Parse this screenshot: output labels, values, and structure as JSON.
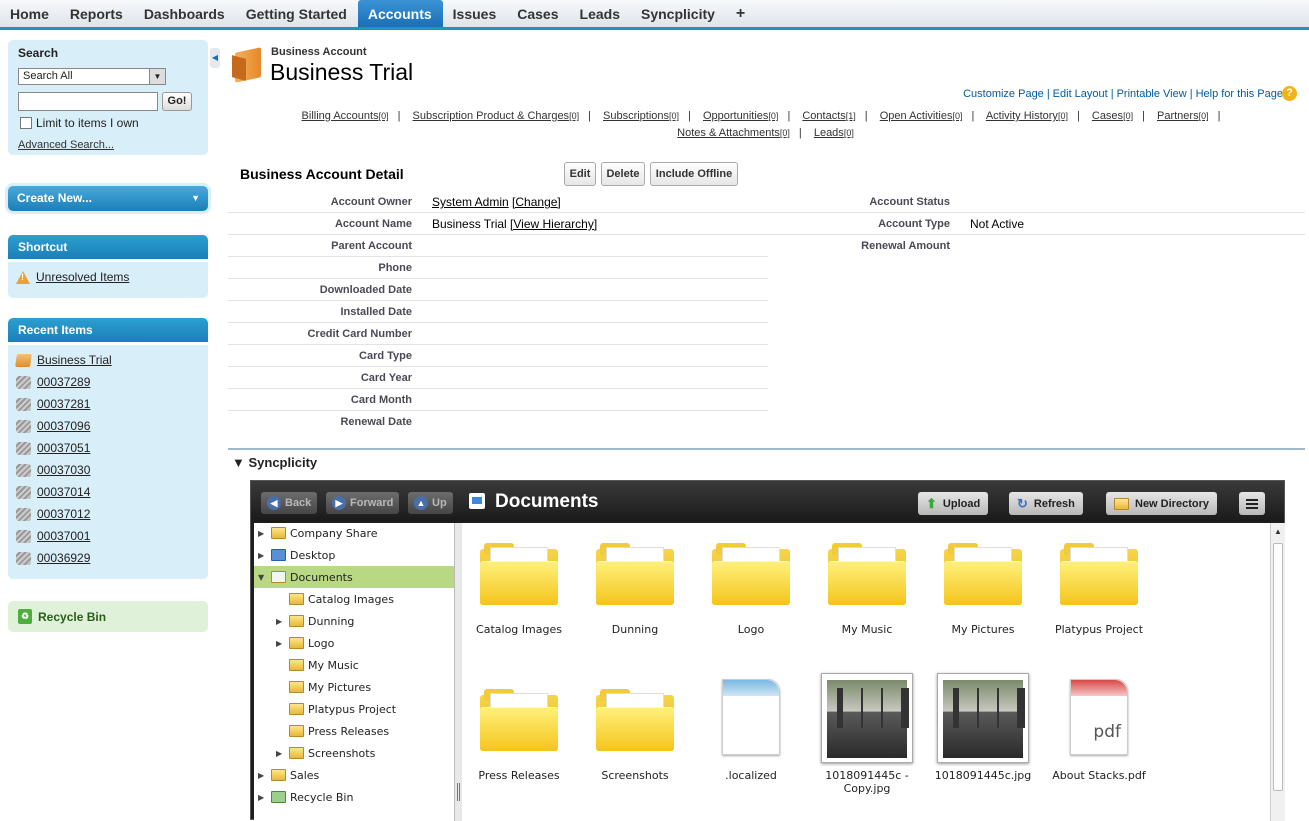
{
  "nav": {
    "tabs": [
      "Home",
      "Reports",
      "Dashboards",
      "Getting Started",
      "Accounts",
      "Issues",
      "Cases",
      "Leads",
      "Syncplicity"
    ],
    "active_tab": "Accounts",
    "plus": "+"
  },
  "sidebar": {
    "search_title": "Search",
    "search_scope": "Search All",
    "search_value": "",
    "go_label": "Go!",
    "limit_label": "Limit to items I own",
    "advanced_label": "Advanced Search...",
    "create_new_label": "Create New...",
    "shortcut_title": "Shortcut",
    "shortcut_items": [
      "Unresolved Items"
    ],
    "recent_title": "Recent Items",
    "recent_items": [
      "Business Trial",
      "00037289",
      "00037281",
      "00037096",
      "00037051",
      "00037030",
      "00037014",
      "00037012",
      "00037001",
      "00036929"
    ],
    "recycle_label": "Recycle Bin"
  },
  "header": {
    "record_type": "Business Account",
    "record_name": "Business Trial",
    "links": [
      "Customize Page",
      "Edit Layout",
      "Printable View",
      "Help for this Page"
    ]
  },
  "related_lists": [
    {
      "label": "Billing Accounts",
      "count": "[0]"
    },
    {
      "label": "Subscription Product & Charges",
      "count": "[0]"
    },
    {
      "label": "Subscriptions",
      "count": "[0]"
    },
    {
      "label": "Opportunities",
      "count": "[0]"
    },
    {
      "label": "Contacts",
      "count": "[1]"
    },
    {
      "label": "Open Activities",
      "count": "[0]"
    },
    {
      "label": "Activity History",
      "count": "[0]"
    },
    {
      "label": "Cases",
      "count": "[0]"
    },
    {
      "label": "Partners",
      "count": "[0]"
    },
    {
      "label": "Notes & Attachments",
      "count": "[0]"
    },
    {
      "label": "Leads",
      "count": "[0]"
    }
  ],
  "detail": {
    "title": "Business Account Detail",
    "buttons": [
      "Edit",
      "Delete",
      "Include Offline"
    ],
    "left_fields": [
      {
        "label": "Account Owner",
        "value": "System Admin",
        "link": "[Change]"
      },
      {
        "label": "Account Name",
        "value": "Business Trial",
        "link": "[View Hierarchy]"
      },
      {
        "label": "Parent Account",
        "value": "",
        "link": ""
      },
      {
        "label": "Phone",
        "value": "",
        "link": ""
      },
      {
        "label": "Downloaded Date",
        "value": "",
        "link": ""
      },
      {
        "label": "Installed Date",
        "value": "",
        "link": ""
      },
      {
        "label": "Credit Card Number",
        "value": "",
        "link": ""
      },
      {
        "label": "Card Type",
        "value": "",
        "link": ""
      },
      {
        "label": "Card Year",
        "value": "",
        "link": ""
      },
      {
        "label": "Card Month",
        "value": "",
        "link": ""
      },
      {
        "label": "Renewal Date",
        "value": "",
        "link": ""
      }
    ],
    "right_fields": [
      {
        "label": "Account Status",
        "value": ""
      },
      {
        "label": "Account Type",
        "value": "Not Active"
      },
      {
        "label": "Renewal Amount",
        "value": ""
      }
    ]
  },
  "syncplicity": {
    "section_title": "Syncplicity",
    "back": "Back",
    "forward": "Forward",
    "up": "Up",
    "folder_title": "Documents",
    "upload": "Upload",
    "refresh": "Refresh",
    "new_directory": "New Directory",
    "tree": [
      "Company Share",
      "Desktop",
      "Documents",
      "Catalog Images",
      "Dunning",
      "Logo",
      "My Music",
      "My Pictures",
      "Platypus Project",
      "Press Releases",
      "Screenshots",
      "Sales",
      "Recycle Bin"
    ],
    "files": [
      {
        "name": "Catalog Images",
        "kind": "folder"
      },
      {
        "name": "Dunning",
        "kind": "folder"
      },
      {
        "name": "Logo",
        "kind": "folder"
      },
      {
        "name": "My Music",
        "kind": "folder"
      },
      {
        "name": "My Pictures",
        "kind": "folder"
      },
      {
        "name": "Platypus Project",
        "kind": "folder"
      },
      {
        "name": "Press Releases",
        "kind": "folder"
      },
      {
        "name": "Screenshots",
        "kind": "folder"
      },
      {
        "name": ".localized",
        "kind": "file"
      },
      {
        "name": "1018091445c - Copy.jpg",
        "kind": "image"
      },
      {
        "name": "1018091445c.jpg",
        "kind": "image"
      },
      {
        "name": "About Stacks.pdf",
        "kind": "pdf",
        "badge": "pdf"
      }
    ]
  },
  "colors": {
    "accent": "#1797c0",
    "active_tab": "#1a6fb5",
    "sidebar_bg": "#d8eef8",
    "selection": "#b9d884"
  }
}
